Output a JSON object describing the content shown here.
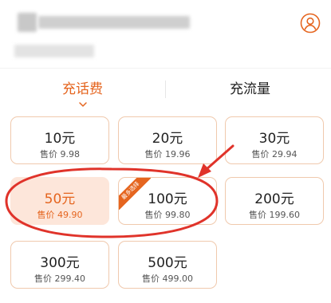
{
  "tabs": [
    {
      "label": "充话费",
      "active": true
    },
    {
      "label": "充流量",
      "active": false
    }
  ],
  "products": [
    {
      "amount": "10元",
      "price": "售价 9.98"
    },
    {
      "amount": "20元",
      "price": "售价 19.96"
    },
    {
      "amount": "30元",
      "price": "售价 29.94"
    },
    {
      "amount": "50元",
      "price": "售价 49.90",
      "selected": true
    },
    {
      "amount": "100元",
      "price": "售价 99.80",
      "badge": "最多选择"
    },
    {
      "amount": "200元",
      "price": "售价 199.60"
    },
    {
      "amount": "300元",
      "price": "售价 299.40"
    },
    {
      "amount": "500元",
      "price": "售价 499.00"
    }
  ],
  "colors": {
    "accent": "#e5651f",
    "card_border": "#f0c9ad",
    "selected_bg": "#fde6da",
    "annotation_red": "#e0332a"
  },
  "icons": {
    "profile": "user-circle-icon",
    "tab_indicator": "chevron-down-icon"
  }
}
